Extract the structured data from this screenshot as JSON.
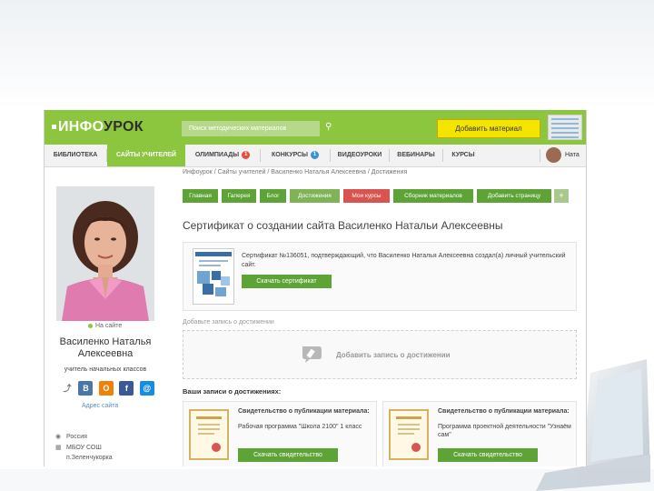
{
  "header": {
    "logo_left": "ИНФО",
    "logo_right": "УРОК",
    "search_placeholder": "Поиск методических материалов",
    "add_material": "Добавить материал"
  },
  "nav": {
    "items": [
      {
        "label": "БИБЛИОТЕКА"
      },
      {
        "label": "САЙТЫ УЧИТЕЛЕЙ"
      },
      {
        "label": "ОЛИМПИАДЫ",
        "badge": "1"
      },
      {
        "label": "КОНКУРСЫ",
        "badge": "1"
      },
      {
        "label": "ВИДЕОУРОКИ"
      },
      {
        "label": "ВЕБИНАРЫ"
      },
      {
        "label": "КУРСЫ"
      }
    ],
    "user_name": "Ната"
  },
  "breadcrumb": [
    "Инфоурок",
    "Сайты учителей",
    "Василенко Наталья Алексеевна",
    "Достижения"
  ],
  "profile": {
    "status": "На сайте",
    "name": "Василенко Наталья Алексеевна",
    "role": "учитель начальных классов",
    "address_link": "Адрес сайта",
    "country": "Россия",
    "school": "МБОУ СОШ",
    "city": "п.Зеленчукорка"
  },
  "tabs": [
    {
      "label": "Главная",
      "color": "#5ea336"
    },
    {
      "label": "Галерея",
      "color": "#5ea336"
    },
    {
      "label": "Блог",
      "color": "#5ea336"
    },
    {
      "label": "Достижения",
      "color": "#7fb356"
    },
    {
      "label": "Мои курсы",
      "color": "#d9534f"
    },
    {
      "label": "Сборник материалов",
      "color": "#5ea336"
    },
    {
      "label": "Добавить страницу",
      "color": "#5ea336"
    },
    {
      "label": "+",
      "color": "#a9c98c"
    }
  ],
  "page_title": "Сертификат о создании сайта Василенко Натальи Алексеевны",
  "certificate": {
    "text": "Сертификат №136051, подтверждающий, что Василенко Наталья Алексеевна создал(а) личный учительский сайт.",
    "button": "Скачать сертификат"
  },
  "add_achievement": {
    "label": "Добавьте запись о достижении",
    "button_text": "Добавить запись о достижении"
  },
  "records": {
    "label": "Ваши записи о достижениях:",
    "items": [
      {
        "title": "Свидетельство о публикации материала:",
        "subtitle": "Рабочая программа \"Школа 2100\" 1 класс",
        "button": "Скачать свидетельство"
      },
      {
        "title": "Свидетельство о публикации материала:",
        "subtitle": "Программа проектной деятельности \"Узнаём сам\"",
        "button": "Скачать свидетельство"
      }
    ]
  },
  "colors": {
    "brand_green": "#8cc63f",
    "button_green": "#5ea336",
    "add_yellow": "#f3e500",
    "badge_red": "#e74c3c",
    "badge_blue": "#3b8fd6"
  }
}
